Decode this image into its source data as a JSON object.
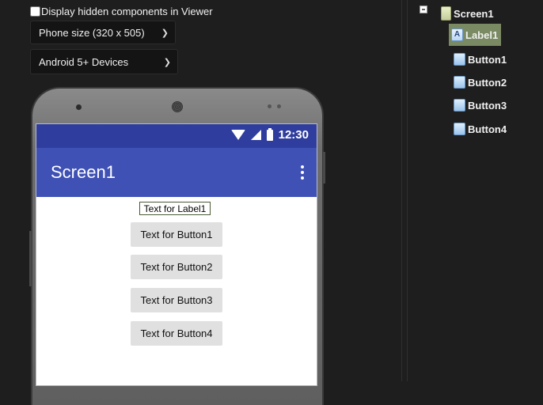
{
  "viewer": {
    "display_hidden_label": "Display hidden components in Viewer",
    "display_hidden_checked": false,
    "phone_size": "Phone size (320 x 505)",
    "device_theme": "Android 5+ Devices"
  },
  "phone": {
    "time": "12:30",
    "screen_title": "Screen1",
    "label_text": "Text for Label1",
    "buttons": [
      "Text for Button1",
      "Text for Button2",
      "Text for Button3",
      "Text for Button4"
    ]
  },
  "tree": {
    "root": "Screen1",
    "children": [
      "Label1",
      "Button1",
      "Button2",
      "Button3",
      "Button4"
    ],
    "selected": "Label1"
  },
  "icons": {
    "collapse": "minus-box-icon",
    "screen": "screen-icon",
    "label": "label-icon",
    "button": "button-icon",
    "status": [
      "wifi-icon",
      "signal-icon",
      "battery-icon"
    ],
    "menu": "more-vert-icon"
  },
  "colors": {
    "status_bar": "#2f3e9e",
    "app_bar": "#3f51b5",
    "selected_node": "#7a8a62"
  }
}
